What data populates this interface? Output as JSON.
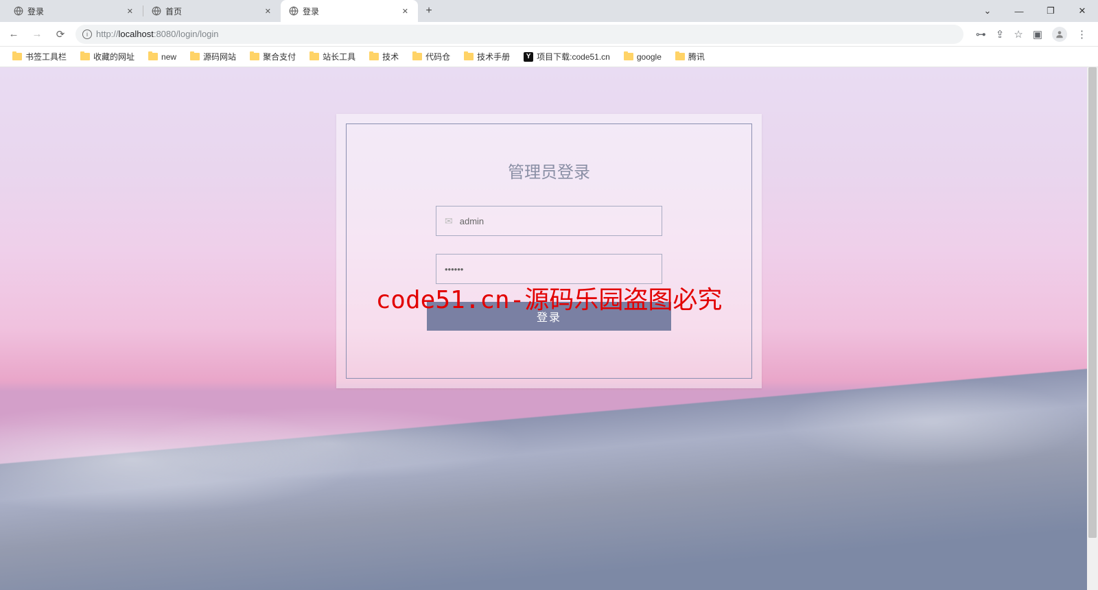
{
  "tabs": [
    {
      "title": "登录"
    },
    {
      "title": "首页"
    },
    {
      "title": "登录"
    }
  ],
  "url": {
    "host_prefix": "http://",
    "host": "localhost",
    "port_path": ":8080/login/login"
  },
  "bookmarks": [
    {
      "type": "folder",
      "label": "书签工具栏"
    },
    {
      "type": "folder",
      "label": "收藏的网址"
    },
    {
      "type": "folder",
      "label": "new"
    },
    {
      "type": "folder",
      "label": "源码网站"
    },
    {
      "type": "folder",
      "label": "聚合支付"
    },
    {
      "type": "folder",
      "label": "站长工具"
    },
    {
      "type": "folder",
      "label": "技术"
    },
    {
      "type": "folder",
      "label": "代码仓"
    },
    {
      "type": "folder",
      "label": "技术手册"
    },
    {
      "type": "y",
      "label": "项目下载:code51.cn"
    },
    {
      "type": "folder",
      "label": "google"
    },
    {
      "type": "folder",
      "label": "腾讯"
    }
  ],
  "login": {
    "title": "管理员登录",
    "username_value": "admin",
    "password_value": "••••••",
    "submit_label": "登录"
  },
  "watermark": "code51.cn-源码乐园盗图必究"
}
